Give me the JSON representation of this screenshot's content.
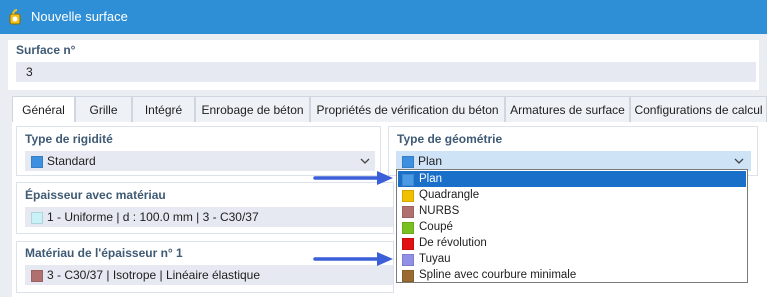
{
  "window": {
    "title": "Nouvelle surface"
  },
  "surface": {
    "label": "Surface n°",
    "value": "3"
  },
  "tabs": [
    {
      "label": "Général",
      "active": true
    },
    {
      "label": "Grille"
    },
    {
      "label": "Intégré"
    },
    {
      "label": "Enrobage de béton"
    },
    {
      "label": "Propriétés de vérification du béton"
    },
    {
      "label": "Armatures de surface"
    },
    {
      "label": "Configurations de calcul"
    }
  ],
  "stiffness": {
    "label": "Type de rigidité",
    "value": "Standard",
    "color": "#3d8fe0"
  },
  "geometry": {
    "label": "Type de géométrie",
    "value": "Plan",
    "color": "#3d8fe0",
    "options": [
      {
        "label": "Plan",
        "color": "#4a9ae6",
        "selected": true
      },
      {
        "label": "Quadrangle",
        "color": "#f0c000"
      },
      {
        "label": "NURBS",
        "color": "#b07070"
      },
      {
        "label": "Coupé",
        "color": "#7ac020"
      },
      {
        "label": "De révolution",
        "color": "#e01010"
      },
      {
        "label": "Tuyau",
        "color": "#9090e8"
      },
      {
        "label": "Spline avec courbure minimale",
        "color": "#9a6a30"
      }
    ]
  },
  "thickness": {
    "label": "Épaisseur avec matériau",
    "value": "1 - Uniforme | d : 100.0 mm | 3 - C30/37",
    "color": "#c9f2f8"
  },
  "material": {
    "label": "Matériau de l'épaisseur n° 1",
    "value": "3 - C30/37 | Isotrope | Linéaire élastique",
    "color": "#b07070"
  },
  "colors": {
    "accent": "#2e8fd6",
    "arrow": "#3a5fd8",
    "selection": "#1a6fc8"
  }
}
